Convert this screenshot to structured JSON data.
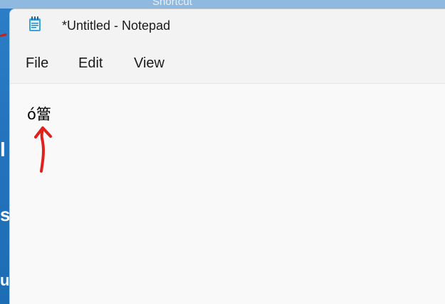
{
  "desktop": {
    "shortcut_label": "Shortcut",
    "edge_glyphs": [
      "l",
      "s",
      "u"
    ]
  },
  "window": {
    "title": "*Untitled - Notepad",
    "icon": "notepad-icon"
  },
  "menu": {
    "items": [
      "File",
      "Edit",
      "View"
    ]
  },
  "editor": {
    "content": "ó簹"
  },
  "annotation": {
    "icon": "red-up-arrow",
    "color": "#e0201c"
  },
  "colors": {
    "titlebar": "#f3f3f3",
    "editor_bg": "#f9f9f9",
    "desktop": "#2475bd"
  }
}
